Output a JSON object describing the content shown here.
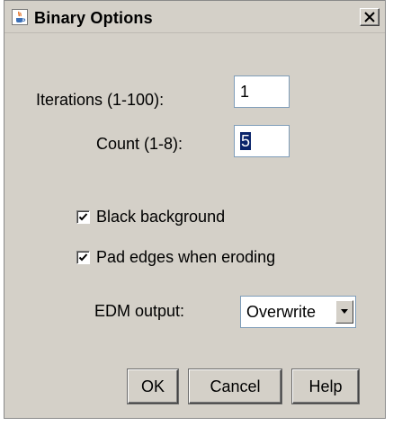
{
  "window": {
    "title": "Binary Options",
    "close_label": "X"
  },
  "form": {
    "iterations": {
      "label": "Iterations (1-100):",
      "value": "1"
    },
    "count": {
      "label": "Count (1-8):",
      "value": "5"
    },
    "black_background": {
      "label": "Black background",
      "checked": true
    },
    "pad_edges": {
      "label": "Pad edges when eroding",
      "checked": true
    },
    "edm_output": {
      "label": "EDM output:",
      "selected": "Overwrite"
    }
  },
  "buttons": {
    "ok": "OK",
    "cancel": "Cancel",
    "help": "Help"
  },
  "colors": {
    "dialog_bg": "#d4d0c8",
    "selection_bg": "#0a246a"
  },
  "icons": {
    "app": "java-cup-icon",
    "close": "close-icon",
    "check": "checkmark-icon",
    "dropdown": "chevron-down-icon"
  }
}
